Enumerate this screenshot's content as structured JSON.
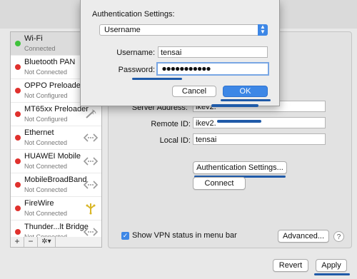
{
  "sidebar": {
    "items": [
      {
        "name": "Wi-Fi",
        "status": "Connected",
        "dot": "#3fc23b",
        "icon": ""
      },
      {
        "name": "Bluetooth PAN",
        "status": "Not Connected",
        "dot": "#e0312d",
        "icon": ""
      },
      {
        "name": "OPPO Preloader",
        "status": "Not Configured",
        "dot": "#e0312d",
        "icon": ""
      },
      {
        "name": "MT65xx Preloader",
        "status": "Not Configured",
        "dot": "#e0312d",
        "icon": "phone-icon"
      },
      {
        "name": "Ethernet",
        "status": "Not Connected",
        "dot": "#e0312d",
        "icon": "ethernet-icon"
      },
      {
        "name": "HUAWEI Mobile",
        "status": "Not Connected",
        "dot": "#e0312d",
        "icon": "ethernet-icon"
      },
      {
        "name": "MobileBroadBand",
        "status": "Not Connected",
        "dot": "#e0312d",
        "icon": "ethernet-icon"
      },
      {
        "name": "FireWire",
        "status": "Not Connected",
        "dot": "#e0312d",
        "icon": "firewire-icon"
      },
      {
        "name": "Thunder...lt Bridge",
        "status": "Not Connected",
        "dot": "#e0312d",
        "icon": "ethernet-icon"
      }
    ],
    "add_label": "+",
    "remove_label": "−",
    "gear_label": "✲▾"
  },
  "panel": {
    "server_address_label": "Server Address:",
    "server_address_value": "ikev2.",
    "remote_id_label": "Remote ID:",
    "remote_id_value": "ikev2.",
    "local_id_label": "Local ID:",
    "local_id_value": "tensai",
    "auth_settings_button": "Authentication Settings...",
    "connect_button": "Connect",
    "show_vpn_label": "Show VPN status in menu bar",
    "show_vpn_checked": true,
    "advanced_button": "Advanced...",
    "help_label": "?"
  },
  "footer": {
    "revert_button": "Revert",
    "apply_button": "Apply"
  },
  "sheet": {
    "title": "Authentication Settings:",
    "method_selected": "Username",
    "username_label": "Username:",
    "username_value": "tensai",
    "password_label": "Password:",
    "password_dots": 11,
    "cancel_button": "Cancel",
    "ok_button": "OK",
    "accent": "#3d87e6"
  },
  "annotation_color": "#1f5aa8"
}
